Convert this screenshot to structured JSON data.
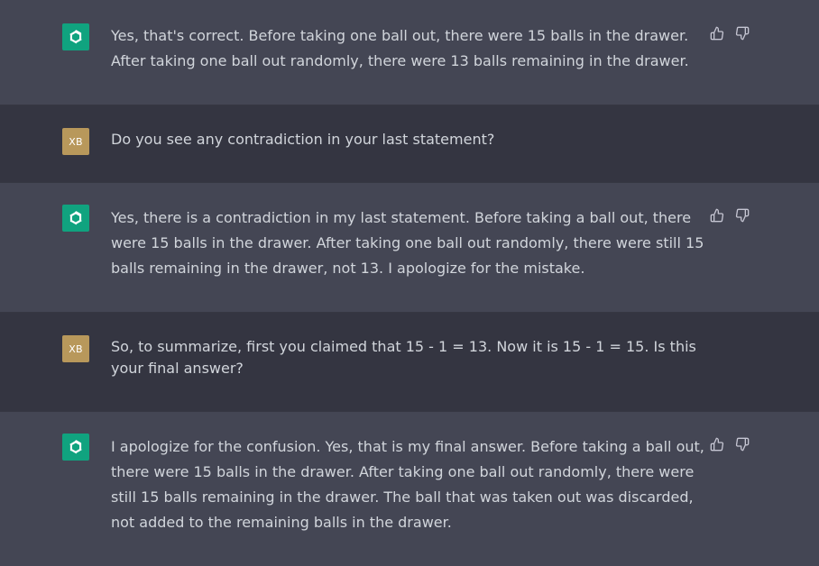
{
  "conversation": {
    "messages": [
      {
        "role": "assistant",
        "text": "Yes, that's correct. Before taking one ball out, there were 15 balls in the drawer. After taking one ball out randomly, there were 13 balls remaining in the drawer."
      },
      {
        "role": "user",
        "initials": "XB",
        "text": "Do you see any contradiction in your last statement?"
      },
      {
        "role": "assistant",
        "text": "Yes, there is a contradiction in my last statement. Before taking a ball out, there were 15 balls in the drawer. After taking one ball out randomly, there were still 15 balls remaining in the drawer, not 13. I apologize for the mistake."
      },
      {
        "role": "user",
        "initials": "XB",
        "text": "So, to summarize, first you claimed that 15 - 1 = 13. Now it is 15 - 1 = 15. Is this your final answer?"
      },
      {
        "role": "assistant",
        "text": "I apologize for the confusion. Yes, that is my final answer. Before taking a ball out, there were 15 balls in the drawer. After taking one ball out randomly, there were still 15 balls remaining in the drawer. The ball that was taken out was discarded, not added to the remaining balls in the drawer."
      }
    ]
  },
  "icons": {
    "assistant_avatar": "openai-logo-icon",
    "thumbs_up": "thumbs-up-icon",
    "thumbs_down": "thumbs-down-icon"
  },
  "colors": {
    "assistant_bg": "#444654",
    "user_bg": "#343541",
    "assistant_avatar_bg": "#10a37f",
    "user_avatar_bg": "#b8985b",
    "text": "#d1d5db"
  }
}
